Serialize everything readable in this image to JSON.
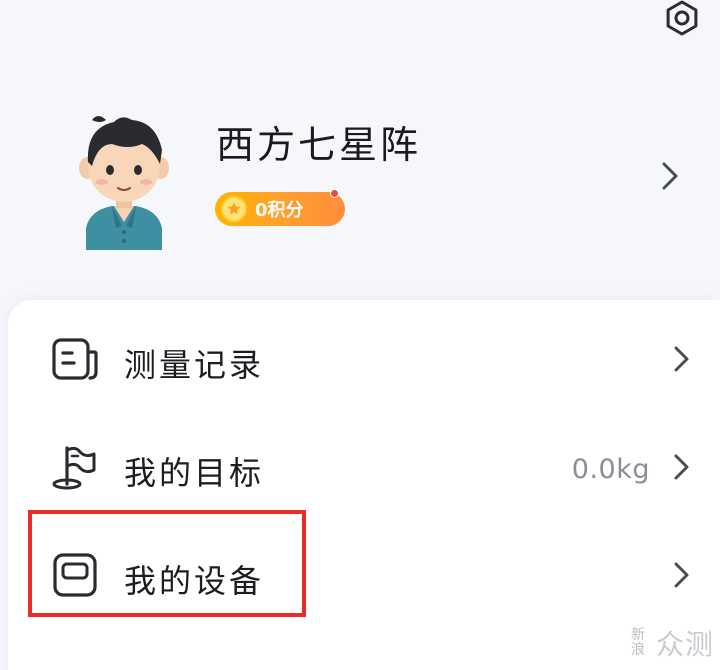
{
  "header": {
    "settings_icon": "gear-icon"
  },
  "profile": {
    "username": "西方七星阵",
    "points_label": "0积分",
    "avatar_icon": "user-avatar",
    "colors": {
      "badge": "#ffa31a",
      "dot": "#f04a3a"
    }
  },
  "menu": {
    "items": [
      {
        "label": "测量记录",
        "icon": "records-icon",
        "value": ""
      },
      {
        "label": "我的目标",
        "icon": "flag-icon",
        "value": "0.0kg"
      },
      {
        "label": "我的设备",
        "icon": "device-icon",
        "value": ""
      }
    ]
  },
  "annotation": {
    "highlight_color": "#ec2a2a"
  },
  "watermark": {
    "mark": "新浪",
    "text": "众测"
  }
}
